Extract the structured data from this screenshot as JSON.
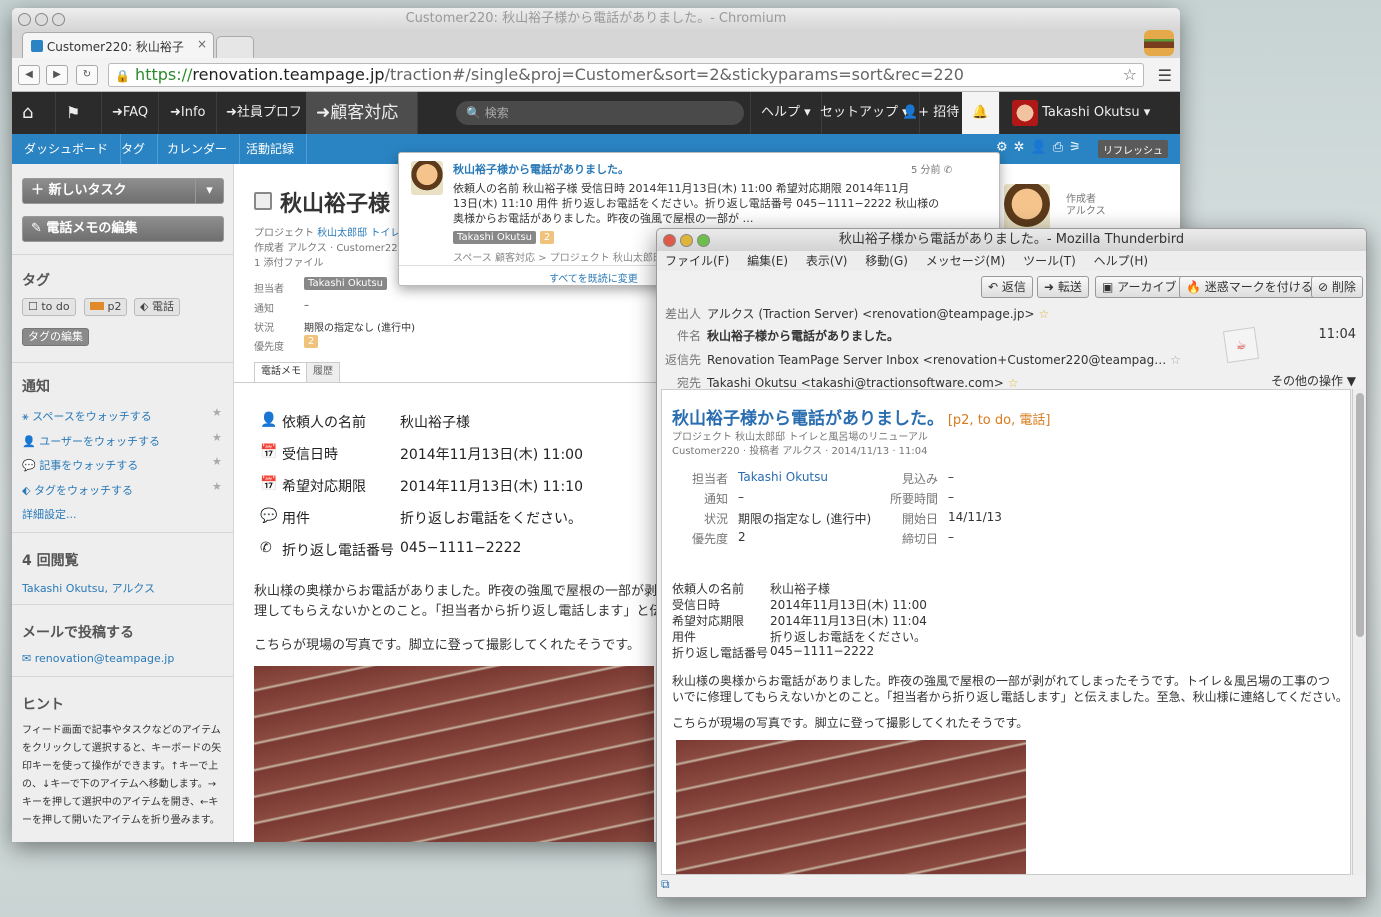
{
  "chrome": {
    "window_title": "Customer220: 秋山裕子様から電話がありました。- Chromium",
    "tab_label": "Customer220: 秋山裕子",
    "url_https": "https://",
    "url_host": "renovation.teampage.jp",
    "url_path": "/traction#/single&proj=Customer&sort=2&stickyparams=sort&rec=220",
    "nav": {
      "faq": "FAQ",
      "info": "Info",
      "staff": "社員プロフ",
      "customer": "顧客対応",
      "search_placeholder": "検索",
      "help": "ヘルプ",
      "setup": "セットアップ",
      "invite": "招待",
      "user": "Takashi Okutsu"
    },
    "subnav": [
      "ダッシュボード",
      "タグ",
      "カレンダー",
      "活動記録"
    ],
    "refresh": "リフレッシュ",
    "sidebar": {
      "new_task": "新しいタスク",
      "edit_memo": "電話メモの編集",
      "tags_heading": "タグ",
      "tag_todo": "to do",
      "tag_p2": "p2",
      "tag_call": "電話",
      "edit_tags": "タグの編集",
      "notify_heading": "通知",
      "watch_space": "スペースをウォッチする",
      "watch_user": "ユーザーをウォッチする",
      "watch_article": "記事をウォッチする",
      "watch_tag": "タグをウォッチする",
      "details": "詳細設定...",
      "views_heading": "4 回閲覧",
      "viewers": "Takashi Okutsu, アルクス",
      "mail_heading": "メールで投稿する",
      "mail_addr": "renovation@teampage.jp",
      "hint_heading": "ヒント",
      "hint_text": "フィード画面で記事やタスクなどのアイテムをクリックして選択すると、キーボードの矢印キーを使って操作ができます。↑キーで上の、↓キーで下のアイテムへ移動します。→キーを押して選択中のアイテムを開き、←キーを押して開いたアイテムを折り畳みます。"
    },
    "article": {
      "title": "秋山裕子様",
      "project_label": "プロジェクト",
      "project_value": "秋山太郎邸 トイレと風",
      "author_line": "作成者 アルクス · Customer220",
      "attach": "1 添付ファイル",
      "assignee_label": "担当者",
      "assignee": "Takashi Okutsu",
      "notify_label": "通知",
      "notify_value": "–",
      "status_label": "状況",
      "status_value": "期限の指定なし (進行中)",
      "priority_label": "優先度",
      "priority_value": "2",
      "tab_memo": "電話メモ",
      "tab_history": "履歴",
      "author_side_label": "作成者",
      "author_side_value": "アルクス",
      "fields": [
        {
          "key": "依頼人の名前",
          "value": "秋山裕子様"
        },
        {
          "key": "受信日時",
          "value": "2014年11月13日(木) 11:00"
        },
        {
          "key": "希望対応期限",
          "value": "2014年11月13日(木) 11:10"
        },
        {
          "key": "用件",
          "value": "折り返しお電話をください。"
        },
        {
          "key": "折り返し電話番号",
          "value": "045−1111−2222"
        }
      ],
      "body1": "秋山様の奥様からお電話がありました。昨夜の強風で屋根の一部が剥",
      "body2": "理してもらえないかとのこと。「担当者から折り返し電話します」と伝えま",
      "body3": "こちらが現場の写真です。脚立に登って撮影してくれたそうです。"
    },
    "popup": {
      "title": "秋山裕子様から電話がありました。",
      "time": "5 分前",
      "text1": "依頼人の名前 秋山裕子様 受信日時 2014年11月13日(木) 11:00 希望対応期限 2014年11月",
      "text2": "13日(木) 11:10 用件 折り返しお電話をください。折り返し電話番号 045−1111−2222 秋山様の",
      "text3": "奥様からお電話がありました。昨夜の強風で屋根の一部が …",
      "badge": "Takashi Okutsu",
      "priority": "2",
      "space_line": "スペース 顧客対応 > プロジェクト 秋山太郎邸",
      "mark_all": "すべてを既読に変更"
    }
  },
  "thunderbird": {
    "window_title": "秋山裕子様から電話がありました。- Mozilla Thunderbird",
    "menu": [
      "ファイル(F)",
      "編集(E)",
      "表示(V)",
      "移動(G)",
      "メッセージ(M)",
      "ツール(T)",
      "ヘルプ(H)"
    ],
    "buttons": {
      "reply": "返信",
      "forward": "転送",
      "archive": "アーカイブ",
      "junk": "迷惑マークを付ける",
      "delete": "削除"
    },
    "headers": {
      "from_label": "差出人",
      "from": "アルクス (Traction Server) <renovation@teampage.jp>",
      "subject_label": "件名",
      "subject": "秋山裕子様から電話がありました。",
      "time": "11:04",
      "reply_label": "返信先",
      "reply_to": "Renovation TeamPage Server Inbox <renovation+Customer220@teampag…",
      "to_label": "宛先",
      "to": "Takashi Okutsu <takashi@tractionsoftware.com>",
      "other": "その他の操作 ▼"
    },
    "msg": {
      "title": "秋山裕子様から電話がありました。",
      "tags": "[p2, to do, 電話]",
      "project": "プロジェクト 秋山太郎邸 トイレと風呂場のリニューアル",
      "meta": "Customer220 · 投稿者 アルクス · 2014/11/13 · 11:04",
      "table": [
        {
          "k": "担当者",
          "v": "Takashi Okutsu",
          "k2": "見込み",
          "v2": "–"
        },
        {
          "k": "通知",
          "v": "–",
          "k2": "所要時間",
          "v2": "–"
        },
        {
          "k": "状況",
          "v": "期限の指定なし (進行中)",
          "k2": "開始日",
          "v2": "14/11/13"
        },
        {
          "k": "優先度",
          "v": "2",
          "k2": "締切日",
          "v2": "–"
        }
      ],
      "fields": [
        {
          "k": "依頼人の名前",
          "v": "秋山裕子様"
        },
        {
          "k": "受信日時",
          "v": "2014年11月13日(木) 11:00"
        },
        {
          "k": "希望対応期限",
          "v": "2014年11月13日(木) 11:04"
        },
        {
          "k": "用件",
          "v": "折り返しお電話をください。"
        },
        {
          "k": "折り返し電話番号",
          "v": "045−1111−2222"
        }
      ],
      "body1": "秋山様の奥様からお電話がありました。昨夜の強風で屋根の一部が剥がれてしまったそうです。トイレ＆風呂場の工事のつ",
      "body2": "いでに修理してもらえないかとのこと。「担当者から折り返し電話します」と伝えました。至急、秋山様に連絡してください。",
      "body3": "こちらが現場の写真です。脚立に登って撮影してくれたそうです。"
    }
  }
}
